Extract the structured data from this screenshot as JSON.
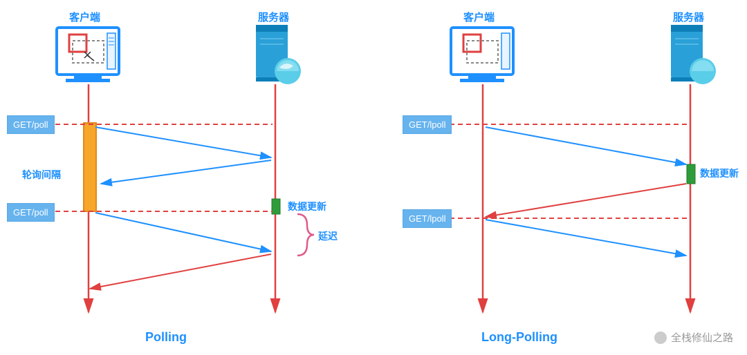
{
  "left": {
    "title": "Polling",
    "client_label": "客户端",
    "server_label": "服务器",
    "requests": [
      "GET/poll",
      "GET/poll"
    ],
    "interval_label": "轮询间隔",
    "data_update_label": "数据更新",
    "delay_label": "延迟"
  },
  "right": {
    "title": "Long-Polling",
    "client_label": "客户端",
    "server_label": "服务器",
    "requests": [
      "GET/lpoll",
      "GET/lpoll"
    ],
    "data_update_label": "数据更新"
  },
  "watermark": "全栈修仙之路",
  "chart_data": [
    {
      "type": "sequence",
      "title": "Polling",
      "actors": [
        "客户端",
        "服务器"
      ],
      "events": [
        {
          "t": 0,
          "from": "客户端",
          "to": "服务器",
          "label": "GET/poll",
          "kind": "request"
        },
        {
          "t": 1,
          "from": "服务器",
          "to": "客户端",
          "label": "",
          "kind": "response-empty"
        },
        {
          "t": 2,
          "note": "轮询间隔",
          "actor": "客户端"
        },
        {
          "t": 3,
          "note": "数据更新",
          "actor": "服务器"
        },
        {
          "t": 4,
          "from": "客户端",
          "to": "服务器",
          "label": "GET/poll",
          "kind": "request"
        },
        {
          "t": 5,
          "from": "服务器",
          "to": "客户端",
          "label": "",
          "kind": "response-data"
        },
        {
          "t": "3→5",
          "note": "延迟"
        }
      ]
    },
    {
      "type": "sequence",
      "title": "Long-Polling",
      "actors": [
        "客户端",
        "服务器"
      ],
      "events": [
        {
          "t": 0,
          "from": "客户端",
          "to": "服务器",
          "label": "GET/lpoll",
          "kind": "request"
        },
        {
          "t": 1,
          "note": "数据更新",
          "actor": "服务器"
        },
        {
          "t": 2,
          "from": "服务器",
          "to": "客户端",
          "label": "",
          "kind": "response-data"
        },
        {
          "t": 3,
          "from": "客户端",
          "to": "服务器",
          "label": "GET/lpoll",
          "kind": "request"
        }
      ]
    }
  ]
}
